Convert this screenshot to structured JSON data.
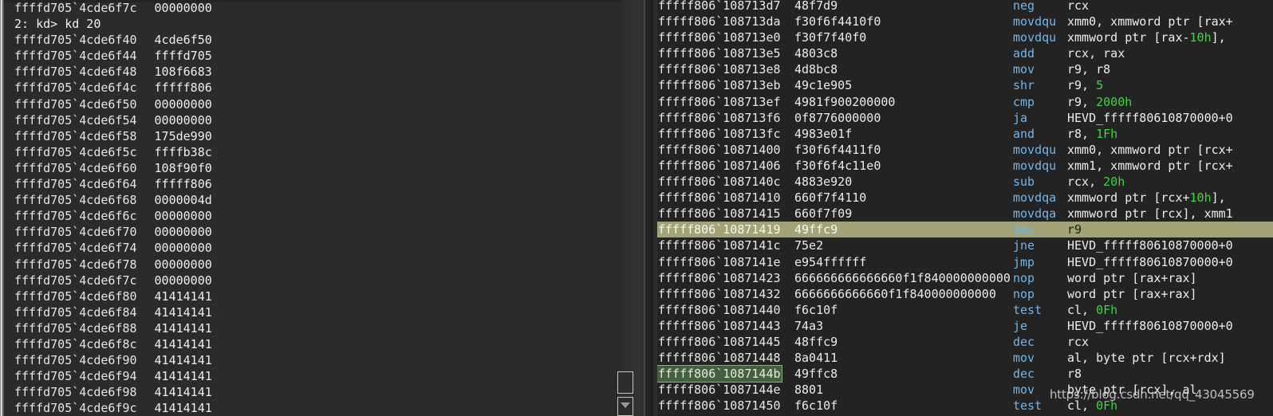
{
  "left_pane": {
    "name": "memory-dump-pane",
    "top_partial_line": {
      "address": "ffffd705`4cde6f7c",
      "value": "00000000"
    },
    "command_line": "2: kd> kd 20",
    "rows": [
      {
        "address": "ffffd705`4cde6f40",
        "value": "4cde6f50"
      },
      {
        "address": "ffffd705`4cde6f44",
        "value": "ffffd705"
      },
      {
        "address": "ffffd705`4cde6f48",
        "value": "108f6683"
      },
      {
        "address": "ffffd705`4cde6f4c",
        "value": "fffff806"
      },
      {
        "address": "ffffd705`4cde6f50",
        "value": "00000000"
      },
      {
        "address": "ffffd705`4cde6f54",
        "value": "00000000"
      },
      {
        "address": "ffffd705`4cde6f58",
        "value": "175de990"
      },
      {
        "address": "ffffd705`4cde6f5c",
        "value": "ffffb38c"
      },
      {
        "address": "ffffd705`4cde6f60",
        "value": "108f90f0"
      },
      {
        "address": "ffffd705`4cde6f64",
        "value": "fffff806"
      },
      {
        "address": "ffffd705`4cde6f68",
        "value": "0000004d"
      },
      {
        "address": "ffffd705`4cde6f6c",
        "value": "00000000"
      },
      {
        "address": "ffffd705`4cde6f70",
        "value": "00000000"
      },
      {
        "address": "ffffd705`4cde6f74",
        "value": "00000000"
      },
      {
        "address": "ffffd705`4cde6f78",
        "value": "00000000"
      },
      {
        "address": "ffffd705`4cde6f7c",
        "value": "00000000"
      },
      {
        "address": "ffffd705`4cde6f80",
        "value": "41414141"
      },
      {
        "address": "ffffd705`4cde6f84",
        "value": "41414141"
      },
      {
        "address": "ffffd705`4cde6f88",
        "value": "41414141"
      },
      {
        "address": "ffffd705`4cde6f8c",
        "value": "41414141"
      },
      {
        "address": "ffffd705`4cde6f90",
        "value": "41414141"
      },
      {
        "address": "ffffd705`4cde6f94",
        "value": "41414141"
      },
      {
        "address": "ffffd705`4cde6f98",
        "value": "41414141"
      },
      {
        "address": "ffffd705`4cde6f9c",
        "value": "41414141"
      }
    ]
  },
  "scrollbar": {
    "thumb_name": "vertical-scroll-thumb",
    "down_button_name": "scroll-down-button"
  },
  "right_pane": {
    "name": "disassembly-pane",
    "highlight_color": "#a3a378",
    "current_instruction_color": "#44603f",
    "rows": [
      {
        "address": "fffff806`108713d7",
        "bytes": "48f7d9",
        "mnemonic": "neg",
        "operands": "rcx"
      },
      {
        "address": "fffff806`108713da",
        "bytes": "f30f6f4410f0",
        "mnemonic": "movdqu",
        "operands": "xmm0, xmmword ptr [rax+"
      },
      {
        "address": "fffff806`108713e0",
        "bytes": "f30f7f40f0",
        "mnemonic": "movdqu",
        "operands": "xmmword ptr [rax-10h], "
      },
      {
        "address": "fffff806`108713e5",
        "bytes": "4803c8",
        "mnemonic": "add",
        "operands": "rcx, rax"
      },
      {
        "address": "fffff806`108713e8",
        "bytes": "4d8bc8",
        "mnemonic": "mov",
        "operands": "r9, r8"
      },
      {
        "address": "fffff806`108713eb",
        "bytes": "49c1e905",
        "mnemonic": "shr",
        "operands": "r9, 5"
      },
      {
        "address": "fffff806`108713ef",
        "bytes": "4981f900200000",
        "mnemonic": "cmp",
        "operands": "r9, 2000h"
      },
      {
        "address": "fffff806`108713f6",
        "bytes": "0f8776000000",
        "mnemonic": "ja",
        "operands": "HEVD_fffff80610870000+0"
      },
      {
        "address": "fffff806`108713fc",
        "bytes": "4983e01f",
        "mnemonic": "and",
        "operands": "r8, 1Fh"
      },
      {
        "address": "fffff806`10871400",
        "bytes": "f30f6f4411f0",
        "mnemonic": "movdqu",
        "operands": "xmm0, xmmword ptr [rcx+"
      },
      {
        "address": "fffff806`10871406",
        "bytes": "f30f6f4c11e0",
        "mnemonic": "movdqu",
        "operands": "xmm1, xmmword ptr [rcx+"
      },
      {
        "address": "fffff806`1087140c",
        "bytes": "4883e920",
        "mnemonic": "sub",
        "operands": "rcx, 20h"
      },
      {
        "address": "fffff806`10871410",
        "bytes": "660f7f4110",
        "mnemonic": "movdqa",
        "operands": "xmmword ptr [rcx+10h], "
      },
      {
        "address": "fffff806`10871415",
        "bytes": "660f7f09",
        "mnemonic": "movdqa",
        "operands": "xmmword ptr [rcx], xmm1"
      },
      {
        "address": "fffff806`10871419",
        "bytes": "49ffc9",
        "mnemonic": "dec",
        "operands": "r9",
        "row_highlight": true
      },
      {
        "address": "fffff806`1087141c",
        "bytes": "75e2",
        "mnemonic": "jne",
        "operands": "HEVD_fffff80610870000+0"
      },
      {
        "address": "fffff806`1087141e",
        "bytes": "e954ffffff",
        "mnemonic": "jmp",
        "operands": "HEVD_fffff80610870000+0"
      },
      {
        "address": "fffff806`10871423",
        "bytes": "666666666666660f1f840000000000",
        "mnemonic": "nop",
        "operands": "word ptr [rax+rax]"
      },
      {
        "address": "fffff806`10871432",
        "bytes": "6666666666660f1f840000000000",
        "mnemonic": "nop",
        "operands": "word ptr [rax+rax]"
      },
      {
        "address": "fffff806`10871440",
        "bytes": "f6c10f",
        "mnemonic": "test",
        "operands": "cl, 0Fh"
      },
      {
        "address": "fffff806`10871443",
        "bytes": "74a3",
        "mnemonic": "je",
        "operands": "HEVD_fffff80610870000+0"
      },
      {
        "address": "fffff806`10871445",
        "bytes": "48ffc9",
        "mnemonic": "dec",
        "operands": "rcx"
      },
      {
        "address": "fffff806`10871448",
        "bytes": "8a0411",
        "mnemonic": "mov",
        "operands": "al, byte ptr [rcx+rdx]"
      },
      {
        "address": "fffff806`1087144b",
        "bytes": "49ffc8",
        "mnemonic": "dec",
        "operands": "r8",
        "address_marked": true
      },
      {
        "address": "fffff806`1087144e",
        "bytes": "8801",
        "mnemonic": "mov",
        "operands": "byte ptr [rcx], al"
      },
      {
        "address": "fffff806`10871450",
        "bytes": "f6c10f",
        "mnemonic": "test",
        "operands": "cl, 0Fh"
      }
    ]
  },
  "watermark": {
    "text": "https://blog.csdn.net/qq_43045569"
  }
}
